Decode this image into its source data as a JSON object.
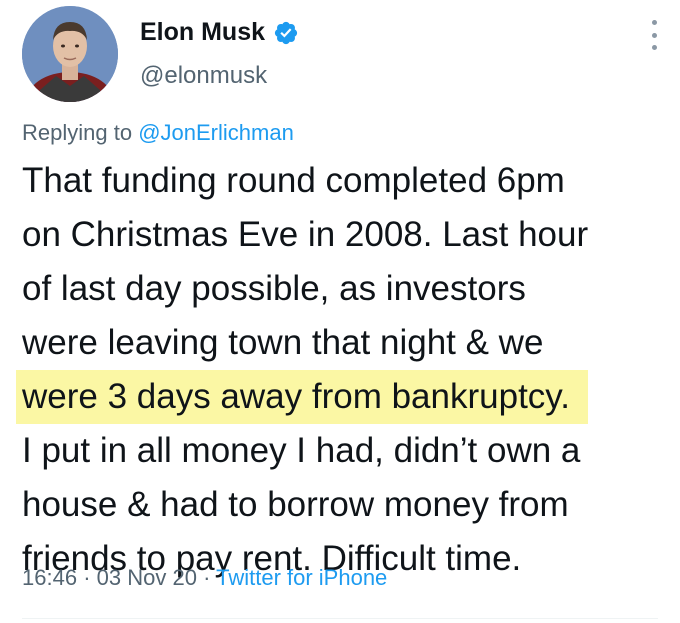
{
  "author": {
    "display_name": "Elon Musk",
    "handle": "@elonmusk",
    "verified_icon": "verified-badge-icon",
    "avatar": "profile-photo"
  },
  "reply": {
    "prefix": "Replying to",
    "mention": "@JonErlichman"
  },
  "body": {
    "lines": [
      "That funding round completed 6pm",
      "on Christmas Eve in 2008. Last hour",
      "of last day possible, as investors",
      "were leaving town that night & we",
      "were 3 days away from bankruptcy.",
      "I put in all money I had, didn’t own a",
      "house & had to borrow money from",
      "friends to pay rent. Difficult time."
    ],
    "highlight_color": "#fbf7a4"
  },
  "meta": {
    "time": "16:46",
    "separator": "·",
    "date": "03 Nov 20",
    "source": "Twitter for iPhone"
  },
  "colors": {
    "text": "#0f1419",
    "secondary": "#536471",
    "link": "#1d9bf0"
  }
}
